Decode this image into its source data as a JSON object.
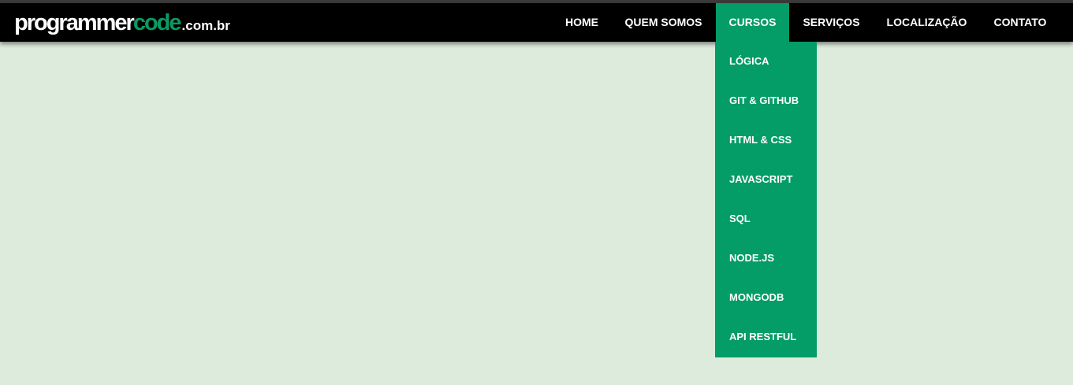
{
  "logo": {
    "part1": "programmer",
    "part2": "code",
    "part3": ".com.br"
  },
  "nav": {
    "items": [
      {
        "label": "HOME"
      },
      {
        "label": "QUEM SOMOS"
      },
      {
        "label": "CURSOS",
        "active": true
      },
      {
        "label": "SERVIÇOS"
      },
      {
        "label": "LOCALIZAÇÃO"
      },
      {
        "label": "CONTATO"
      }
    ]
  },
  "dropdown": {
    "items": [
      {
        "label": "LÓGICA"
      },
      {
        "label": "GIT & GITHUB"
      },
      {
        "label": "HTML & CSS"
      },
      {
        "label": "JAVASCRIPT"
      },
      {
        "label": "SQL"
      },
      {
        "label": "NODE.JS"
      },
      {
        "label": "MONGODB"
      },
      {
        "label": "API RESTFUL"
      }
    ]
  },
  "colors": {
    "background": "#ddebdd",
    "header": "#000000",
    "accent": "#049c67",
    "logo_accent": "#0a9a62"
  }
}
